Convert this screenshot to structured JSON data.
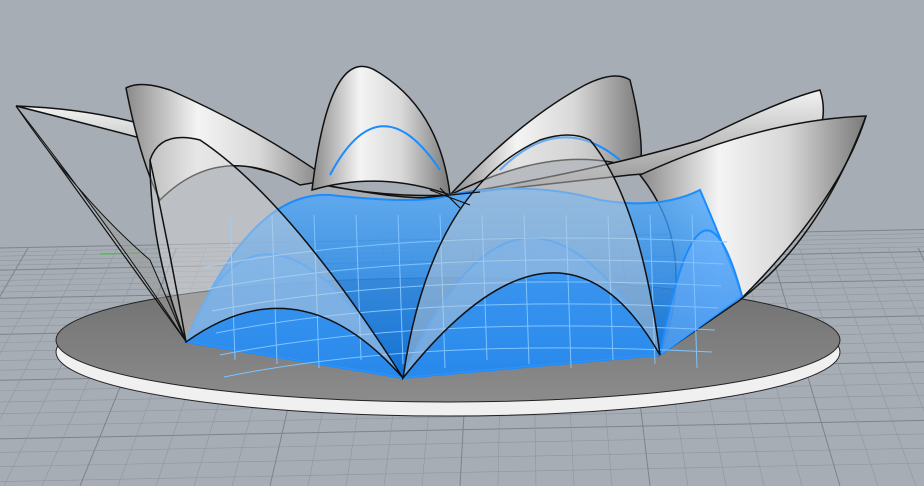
{
  "viewport": {
    "background_color": "#a7adb4",
    "grid_color": "#8f969e",
    "grid_major_color": "#7d848c",
    "selection_color": "#1a8cff",
    "shell_color": "#e6e6e6",
    "edge_color": "#000000",
    "platform_color": "#7f7f7f",
    "axis_x_color": "#c43c3c",
    "axis_y_color": "#3cc43c"
  }
}
